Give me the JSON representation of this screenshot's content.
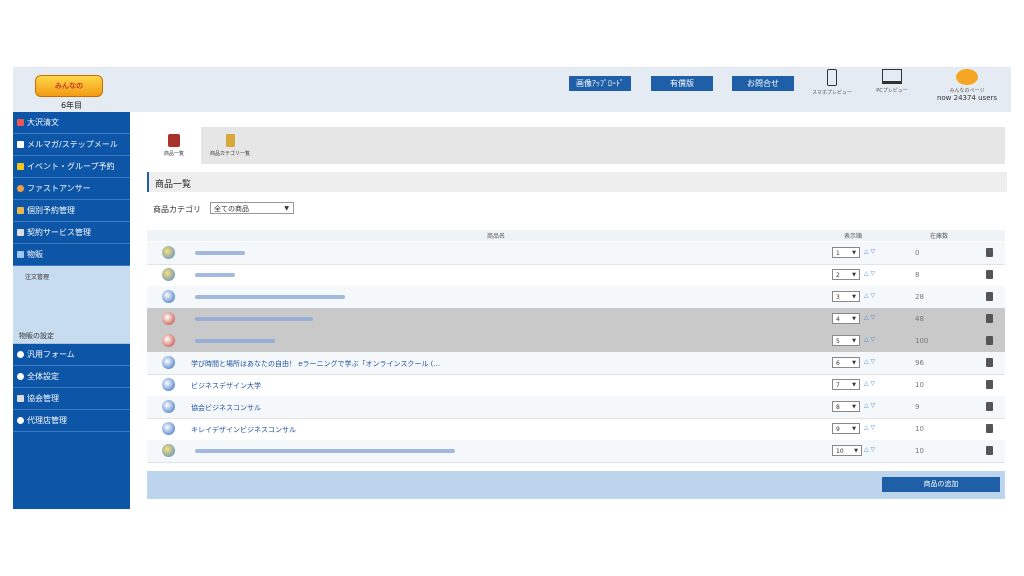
{
  "header": {
    "logo_text": "みんなの",
    "year_label": "6年目",
    "buttons": [
      "画像ｱｯﾌﾟﾛｰﾄﾞ",
      "有償版",
      "お問合せ"
    ],
    "smartphone_preview": "スマホプレビュー",
    "pc_preview": "PCプレビュー",
    "my_page": "みんなのページ",
    "users": "now 24374 users"
  },
  "sidebar": {
    "items": [
      {
        "label": "大沢清文",
        "icon": "card-icon"
      },
      {
        "label": "メルマガ/ステップメール",
        "icon": "mail-icon"
      },
      {
        "label": "イベント・グループ予約",
        "icon": "star-icon"
      },
      {
        "label": "ファストアンサー",
        "icon": "people-icon"
      },
      {
        "label": "個別予約管理",
        "icon": "calendar-icon"
      },
      {
        "label": "契約サービス管理",
        "icon": "document-icon"
      },
      {
        "label": "物販",
        "icon": "cart-icon"
      }
    ],
    "sub_items": [
      "注文管理",
      "物販の設定"
    ],
    "items2": [
      {
        "label": "汎用フォーム",
        "icon": "circle-icon"
      },
      {
        "label": "全体設定",
        "icon": "gear-icon"
      },
      {
        "label": "協会管理",
        "icon": "document-icon"
      },
      {
        "label": "代理店管理",
        "icon": "circle-icon"
      }
    ]
  },
  "tabs": [
    "商品一覧",
    "商品カテゴリ一覧"
  ],
  "section_title": "商品一覧",
  "category": {
    "label": "商品カテゴリ",
    "value": "全ての商品"
  },
  "table": {
    "columns": [
      "商品名",
      "表示順",
      "在庫数"
    ],
    "rows": [
      {
        "name": "",
        "order": "1",
        "stock": "0"
      },
      {
        "name": "",
        "order": "2",
        "stock": "8"
      },
      {
        "name": "",
        "order": "3",
        "stock": "28"
      },
      {
        "name": "",
        "order": "4",
        "stock": "48"
      },
      {
        "name": "",
        "order": "5",
        "stock": "100"
      },
      {
        "name": "学び時間と場所はあなたの自由！ eラーニングで学ぶ「オンラインスクール (...",
        "order": "6",
        "stock": "96"
      },
      {
        "name": "ビジネスデザイン大学",
        "order": "7",
        "stock": "10"
      },
      {
        "name": "協会ビジネスコンサル",
        "order": "8",
        "stock": "9"
      },
      {
        "name": "キレイデザインビジネスコンサル",
        "order": "9",
        "stock": "10"
      },
      {
        "name": "",
        "order": "10",
        "stock": "10"
      }
    ]
  },
  "add_button": "商品の追加",
  "colors": {
    "brand_blue": "#0d55a6",
    "button_blue": "#1e5fa8"
  }
}
